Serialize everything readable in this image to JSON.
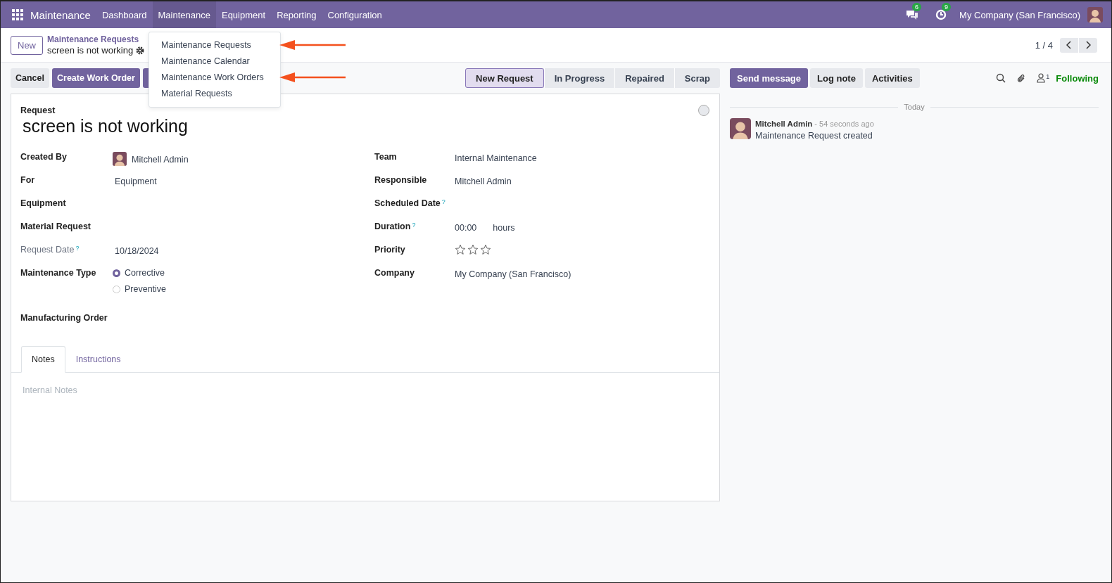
{
  "navbar": {
    "app_name": "Maintenance",
    "menus": [
      {
        "label": "Dashboard",
        "selected": false
      },
      {
        "label": "Maintenance",
        "selected": true
      },
      {
        "label": "Equipment",
        "selected": false
      },
      {
        "label": "Reporting",
        "selected": false
      },
      {
        "label": "Configuration",
        "selected": false
      }
    ],
    "messages_count": "6",
    "activities_count": "9",
    "company": "My Company (San Francisco)"
  },
  "dropdown": {
    "items": [
      {
        "label": "Maintenance Requests",
        "annotated": true
      },
      {
        "label": "Maintenance Calendar",
        "annotated": false
      },
      {
        "label": "Maintenance Work Orders",
        "annotated": true
      },
      {
        "label": "Material Requests",
        "annotated": false
      }
    ]
  },
  "breadcrumb": {
    "new_button": "New",
    "parent": "Maintenance Requests",
    "current": "screen is not working"
  },
  "pager": {
    "text": "1 / 4"
  },
  "actions": [
    {
      "label": "Cancel",
      "kind": "secondary"
    },
    {
      "label": "Create Work Order",
      "kind": "primary"
    },
    {
      "kind": "covered"
    }
  ],
  "stages": [
    {
      "label": "New Request",
      "selected": true
    },
    {
      "label": "In Progress",
      "selected": false
    },
    {
      "label": "Repaired",
      "selected": false
    },
    {
      "label": "Scrap",
      "selected": false
    }
  ],
  "form": {
    "request_label": "Request",
    "title": "screen is not working",
    "left_fields": [
      {
        "label": "Created By",
        "kind": "user",
        "value": "Mitchell Admin",
        "muted": false
      },
      {
        "label": "For",
        "kind": "text",
        "value": "Equipment",
        "muted": false
      },
      {
        "label": "Equipment",
        "kind": "empty",
        "muted": false
      },
      {
        "label": "Material Request",
        "kind": "empty",
        "muted": false
      },
      {
        "label": "Request Date",
        "kind": "text",
        "value": "10/18/2024",
        "muted": true,
        "help": "?"
      },
      {
        "label": "Maintenance Type",
        "kind": "radio",
        "muted": false,
        "options": [
          {
            "label": "Corrective",
            "selected": true
          },
          {
            "label": "Preventive",
            "selected": false
          }
        ]
      },
      {
        "label": "Manufacturing Order",
        "kind": "empty",
        "muted": false
      }
    ],
    "right_fields": [
      {
        "label": "Team",
        "kind": "text",
        "value": "Internal Maintenance",
        "muted": false
      },
      {
        "label": "Responsible",
        "kind": "text",
        "value": "Mitchell Admin",
        "muted": false
      },
      {
        "label": "Scheduled Date",
        "kind": "empty",
        "muted": false,
        "help": "?"
      },
      {
        "label": "Duration",
        "kind": "duration",
        "value": "00:00",
        "unit": "hours",
        "muted": false,
        "help": "?"
      },
      {
        "label": "Priority",
        "kind": "stars",
        "stars": 0,
        "muted": false
      },
      {
        "label": "Company",
        "kind": "text",
        "value": "My Company (San Francisco)",
        "muted": false
      }
    ],
    "tabs": [
      {
        "label": "Notes",
        "selected": true
      },
      {
        "label": "Instructions",
        "selected": false
      }
    ],
    "notes_placeholder": "Internal Notes"
  },
  "chatter": {
    "buttons": [
      {
        "label": "Send message",
        "kind": "primary"
      },
      {
        "label": "Log note",
        "kind": "secondary"
      },
      {
        "label": "Activities",
        "kind": "secondary"
      }
    ],
    "followers_count": "1",
    "follow_label": "Following",
    "date_separator": "Today",
    "messages": [
      {
        "author": "Mitchell Admin",
        "time": "- 54 seconds ago",
        "body": "Maintenance Request created"
      }
    ]
  }
}
